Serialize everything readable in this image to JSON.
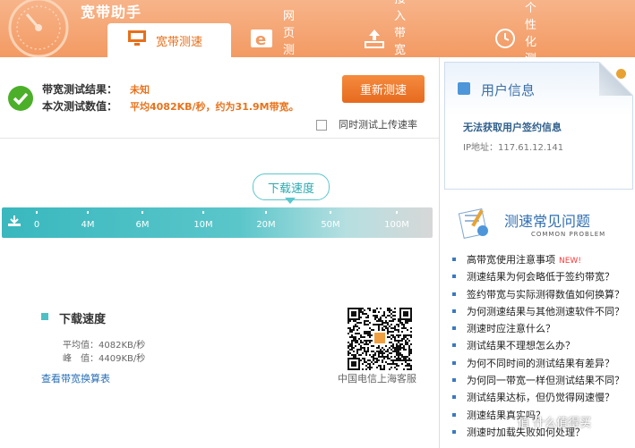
{
  "app": {
    "title": "宽带助手"
  },
  "tabs": [
    {
      "label": "宽带测速",
      "icon": "monitor-icon",
      "active": true
    },
    {
      "label": "网页测速",
      "icon": "ie-icon"
    },
    {
      "label": "接入带宽测试",
      "icon": "upload-icon"
    },
    {
      "label": "个性化测试",
      "icon": "clock-icon"
    }
  ],
  "result": {
    "bandwidth_label": "带宽测试结果：",
    "bandwidth_value": "未知",
    "data_label": "本次测试数值：",
    "data_value": "平均4082KB/秒，约为31.9M带宽。",
    "retest_label": "重新测速",
    "upload_checkbox_label": "同时测试上传速率"
  },
  "speed": {
    "bubble_label": "下载速度",
    "ticks": [
      "0",
      "4M",
      "6M",
      "10M",
      "20M",
      "50M",
      "100M"
    ],
    "legend_title": "下载速度",
    "avg_text": "平均值：4082KB/秒",
    "peak_text": "峰　值：4409KB/秒",
    "calc_link": "查看带宽换算表"
  },
  "qr": {
    "caption": "中国电信上海客服"
  },
  "user": {
    "title": "用户信息",
    "message": "无法获取用户签约信息",
    "ip": "IP地址：117.61.12.141"
  },
  "faq": {
    "title": "测速常见问题",
    "subtitle": "COMMON PROBLEM",
    "new_badge": "NEW!",
    "items": [
      "高带宽使用注意事项",
      "测速结果为何会略低于签约带宽？",
      "签约带宽与实际测得数值如何换算？",
      "为何测速结果与其他测速软件不同？",
      "测速时应注意什么？",
      "测试结果不理想怎么办？",
      "为何不同时间的测试结果有差异？",
      "为何同一带宽一样但测试结果不同？",
      "测试结果达标，但仍觉得网速慢？",
      "测速结果真实吗？",
      "测速时加载失败如何处理？"
    ]
  },
  "watermark": "值 什么值得买",
  "colors": {
    "header": "#f39a63",
    "accent": "#e8731c",
    "bar": "#39b8be",
    "link": "#2a6fb5"
  }
}
